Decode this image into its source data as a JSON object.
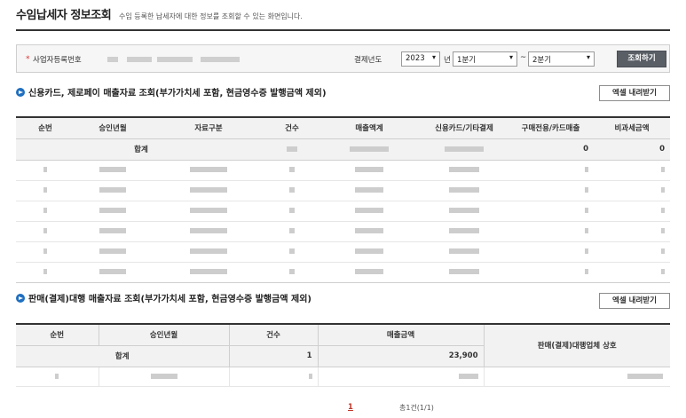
{
  "page": {
    "title": "수임납세자 정보조회",
    "subtitle": "수임 등록한 납세자에 대한 정보를 조회할 수 있는 화면입니다."
  },
  "search": {
    "required_mark": "*",
    "biz_no_label": "사업자등록번호",
    "year_label": "결제년도",
    "year_value": "2023",
    "year_suffix": "년",
    "quarter_from": "1분기",
    "tilde": "~",
    "quarter_to": "2분기",
    "search_button": "조회하기"
  },
  "section1": {
    "title": "신용카드, 제로페이 매출자료 조회(부가가치세 포함, 현금영수증 발행금액 제외)",
    "excel_button": "엑셀 내려받기",
    "columns": [
      "순번",
      "승인년월",
      "자료구분",
      "건수",
      "매출액계",
      "신용카드/기타결제",
      "구매전용/카드매출",
      "비과세금액"
    ],
    "summary": {
      "label": "합계",
      "purchase_only": "0",
      "tax_free": "0"
    }
  },
  "section2": {
    "title": "판매(결제)대행 매출자료 조회(부가가치세 포함, 현금영수증 발행금액 제외)",
    "excel_button": "엑셀 내려받기",
    "columns": [
      "순번",
      "승인년월",
      "건수",
      "매출금액",
      "판매(결제)대행업체 상호"
    ],
    "summary": {
      "label": "합계",
      "count": "1",
      "amount": "23,900"
    }
  },
  "pagination": {
    "current_page": "1",
    "count_text": "총1건(1/1)"
  },
  "colors": {
    "accent_blue": "#1f6fc0",
    "button_dark": "#5a5f66",
    "page_link_red": "#c0392b"
  }
}
